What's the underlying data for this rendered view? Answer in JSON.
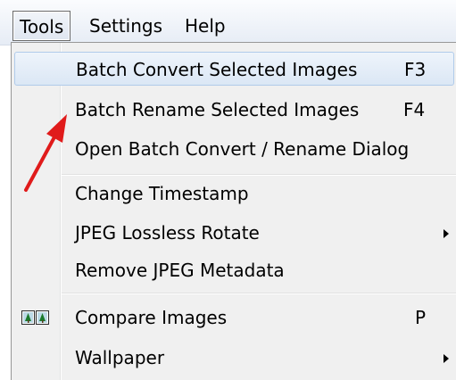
{
  "menubar": {
    "items": [
      {
        "label": "Tools"
      },
      {
        "label": "Settings"
      },
      {
        "label": "Help"
      }
    ]
  },
  "menu": {
    "items": [
      {
        "label": "Batch Convert Selected Images",
        "shortcut": "F3"
      },
      {
        "label": "Batch Rename Selected Images",
        "shortcut": "F4"
      },
      {
        "label": "Open Batch Convert / Rename Dialog"
      },
      {
        "label": "Change Timestamp"
      },
      {
        "label": "JPEG Lossless Rotate"
      },
      {
        "label": "Remove JPEG Metadata"
      },
      {
        "label": "Compare Images",
        "shortcut": "P"
      },
      {
        "label": "Wallpaper"
      }
    ]
  },
  "colors": {
    "highlight": "#dbe7f5",
    "arrow": "#e01b1b",
    "icon": "#1b7a2c"
  }
}
